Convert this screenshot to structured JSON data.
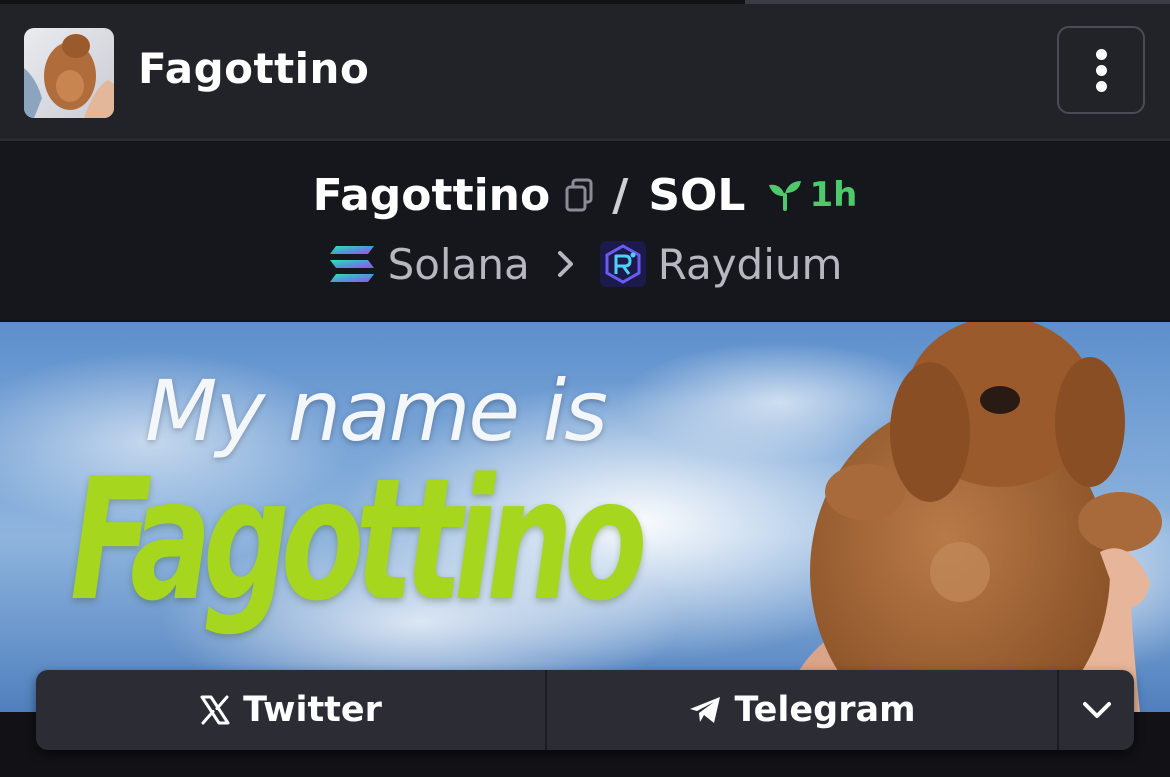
{
  "header": {
    "token_name": "Fagottino",
    "avatar_icon": "puppy-avatar",
    "menu_icon": "vertical-dots-icon"
  },
  "pair": {
    "base_symbol": "Fagottino",
    "separator": "/",
    "quote_symbol": "SOL",
    "age": "1h",
    "age_color": "#4ec96d"
  },
  "chain": {
    "chain_name": "Solana",
    "dex_name": "Raydium"
  },
  "banner": {
    "line1": "My name is",
    "line2": "Fagottino",
    "accent_color": "#a6d61e"
  },
  "social": {
    "twitter_label": "Twitter",
    "telegram_label": "Telegram"
  }
}
